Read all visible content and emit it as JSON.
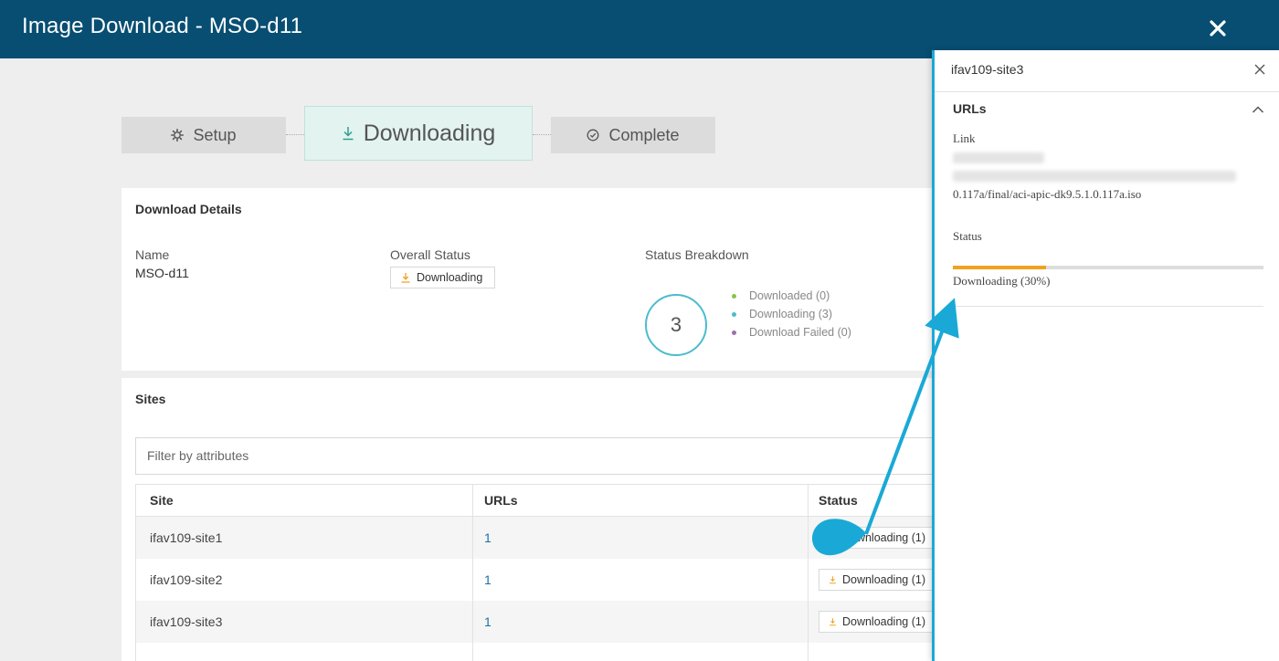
{
  "header": {
    "title": "Image Download - MSO-d11"
  },
  "steps": [
    {
      "label": "Setup"
    },
    {
      "label": "Downloading"
    },
    {
      "label": "Complete"
    }
  ],
  "details": {
    "heading": "Download Details",
    "name_label": "Name",
    "name_value": "MSO-d11",
    "overall_label": "Overall Status",
    "overall_value": "Downloading",
    "breakdown_label": "Status Breakdown",
    "total": "3",
    "legend": [
      {
        "label": "Downloaded (0)",
        "color": "#8bc34a"
      },
      {
        "label": "Downloading (3)",
        "color": "#4bbccd"
      },
      {
        "label": "Download Failed (0)",
        "color": "#9c6fb0"
      }
    ]
  },
  "sites": {
    "heading": "Sites",
    "filter_placeholder": "Filter by attributes",
    "columns": [
      "Site",
      "URLs",
      "Status"
    ],
    "rows": [
      {
        "site": "ifav109-site1",
        "urls": "1",
        "status": "Downloading (1)"
      },
      {
        "site": "ifav109-site2",
        "urls": "1",
        "status": "Downloading (1)"
      },
      {
        "site": "ifav109-site3",
        "urls": "1",
        "status": "Downloading (1)"
      }
    ]
  },
  "panel": {
    "title": "ifav109-site3",
    "section": "URLs",
    "link_label": "Link",
    "link_tail": "0.117a/final/aci-apic-dk9.5.1.0.117a.iso",
    "status_label": "Status",
    "progress_fraction": 0.3,
    "status_text": "Downloading (30%)"
  },
  "colors": {
    "header_bg": "#074e72",
    "accent": "#4bbccd",
    "progress": "#f0a21f",
    "callout": "#1aa9d6"
  }
}
